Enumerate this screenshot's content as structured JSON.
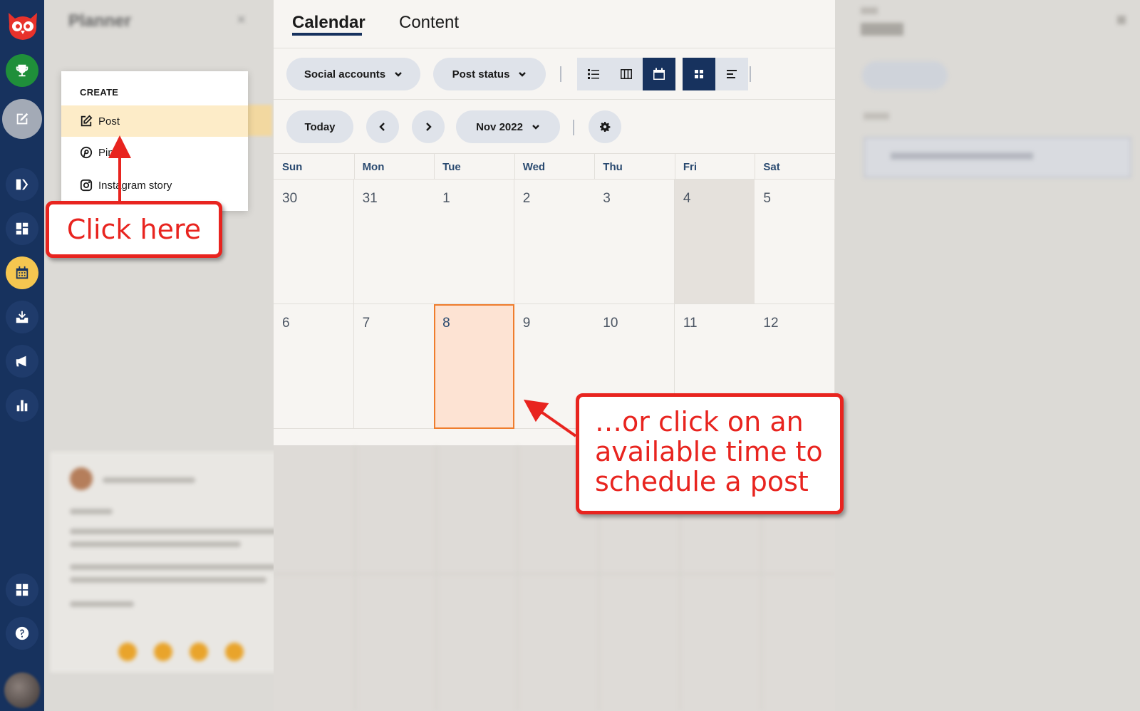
{
  "app": {
    "brand_color": "#17325e",
    "accent_color": "#ef7d2d",
    "callout_color": "#e8241f"
  },
  "rail": {
    "items": [
      {
        "icon": "trophy-icon"
      },
      {
        "icon": "compose-icon"
      },
      {
        "icon": "streams-icon"
      },
      {
        "icon": "dashboard-icon"
      },
      {
        "icon": "calendar-icon"
      },
      {
        "icon": "inbox-icon"
      },
      {
        "icon": "megaphone-icon"
      },
      {
        "icon": "analytics-icon"
      },
      {
        "icon": "apps-icon"
      },
      {
        "icon": "help-icon"
      }
    ]
  },
  "planner": {
    "title": "Planner",
    "create_menu": {
      "heading": "CREATE",
      "items": [
        {
          "label": "Post",
          "icon": "compose-icon"
        },
        {
          "label": "Pin",
          "icon": "pinterest-icon"
        },
        {
          "label": "Instagram story",
          "icon": "instagram-icon"
        }
      ]
    }
  },
  "tabs": [
    {
      "label": "Calendar",
      "active": true
    },
    {
      "label": "Content",
      "active": false
    }
  ],
  "filters": {
    "social_accounts": "Social accounts",
    "post_status": "Post status"
  },
  "nav": {
    "today": "Today",
    "month": "Nov 2022"
  },
  "calendar": {
    "weekdays": [
      "Sun",
      "Mon",
      "Tue",
      "Wed",
      "Thu",
      "Fri",
      "Sat"
    ],
    "weeks": [
      [
        "30",
        "31",
        "1",
        "2",
        "3",
        "4",
        "5"
      ],
      [
        "6",
        "7",
        "8",
        "9",
        "10",
        "11",
        "12"
      ]
    ],
    "today": "4",
    "selected": "8"
  },
  "callouts": {
    "click_here": "Click here",
    "or_click": "…or click on an available time to schedule a post"
  }
}
